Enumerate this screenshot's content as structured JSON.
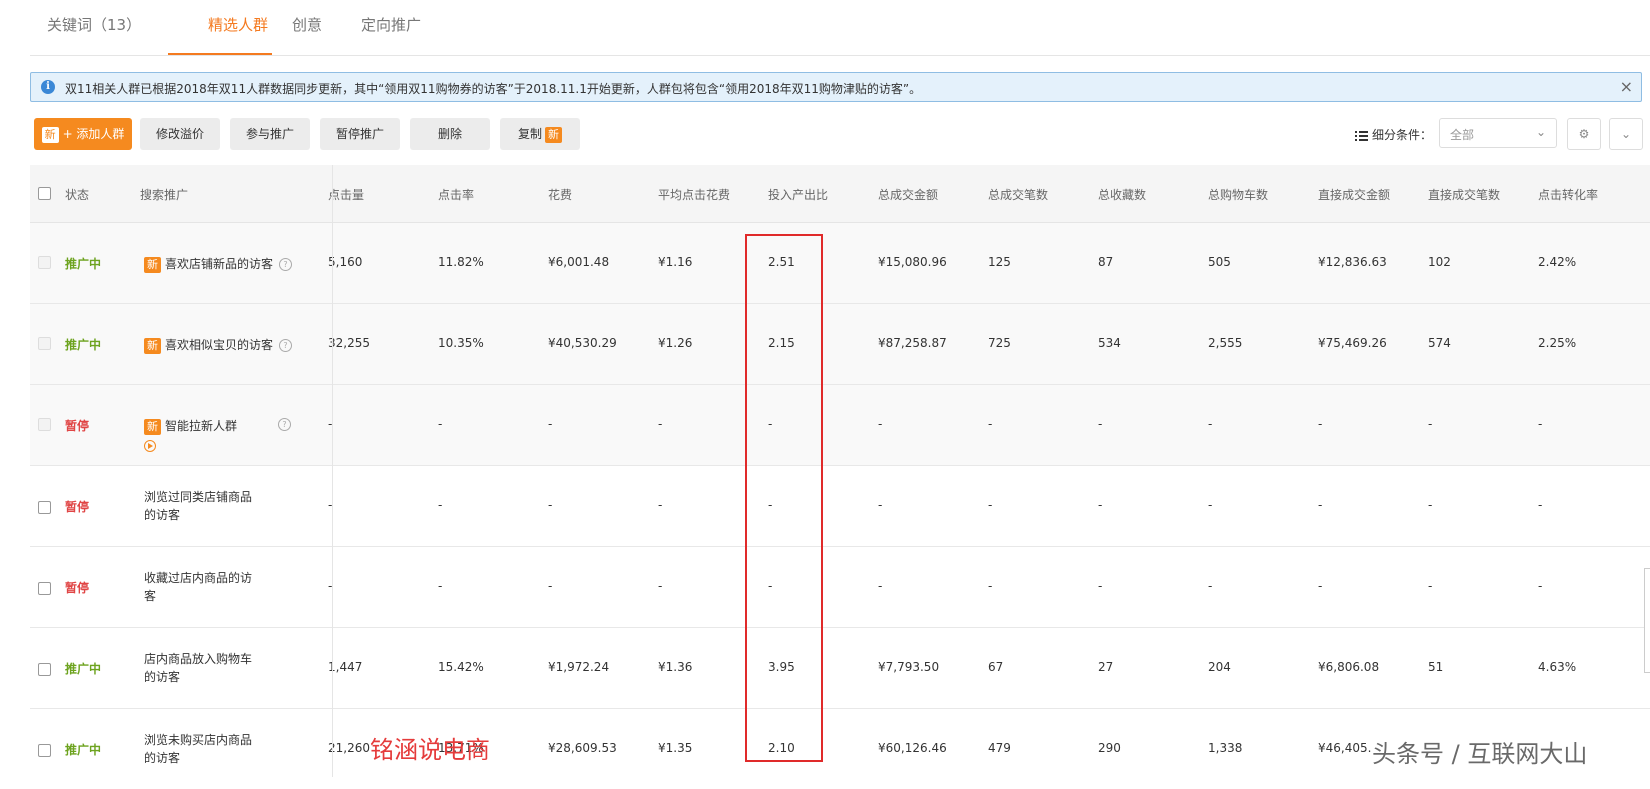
{
  "tabs": [
    {
      "label": "关键词（13）"
    },
    {
      "label": "精选人群"
    },
    {
      "label": "创意"
    },
    {
      "label": "定向推广"
    }
  ],
  "notice": {
    "text": "双11相关人群已根据2018年双11人群数据同步更新，其中“领用双11购物券的访客”于2018.11.1开始更新，人群包将包含“领用2018年双11购物津贴的访客”。",
    "close": "×"
  },
  "toolbar": {
    "add_new_tag": "新",
    "add_label": "+ 添加人群",
    "modify_premium": "修改溢价",
    "join_promo": "参与推广",
    "pause_promo": "暂停推广",
    "delete": "删除",
    "copy": "复制",
    "copy_tag": "新",
    "filter_label": "细分条件：",
    "filter_value": "全部"
  },
  "table": {
    "headers": [
      "状态",
      "搜索推广",
      "点击量",
      "点击率",
      "花费",
      "平均点击花费",
      "投入产出比",
      "总成交金额",
      "总成交笔数",
      "总收藏数",
      "总购物车数",
      "直接成交金额",
      "直接成交笔数",
      "点击转化率"
    ],
    "rows": [
      {
        "status": "推广中",
        "status_type": "on",
        "new": "新",
        "name1": "喜欢店铺新品的访客",
        "name2": "",
        "help": "?",
        "clicks": "5,160",
        "ctr": "11.82%",
        "cost": "¥6,001.48",
        "cpc": "¥1.16",
        "roi": "2.51",
        "gmv": "¥15,080.96",
        "orders": "125",
        "favs": "87",
        "carts": "505",
        "direct_gmv": "¥12,836.63",
        "direct_orders": "102",
        "cvr": "2.42%"
      },
      {
        "status": "推广中",
        "status_type": "on",
        "new": "新",
        "name1": "喜欢相似宝贝的访客",
        "name2": "",
        "help": "?",
        "clicks": "32,255",
        "ctr": "10.35%",
        "cost": "¥40,530.29",
        "cpc": "¥1.26",
        "roi": "2.15",
        "gmv": "¥87,258.87",
        "orders": "725",
        "favs": "534",
        "carts": "2,555",
        "direct_gmv": "¥75,469.26",
        "direct_orders": "574",
        "cvr": "2.25%"
      },
      {
        "status": "暂停",
        "status_type": "off",
        "new": "新",
        "name1": "智能拉新人群",
        "name2": "",
        "help": "?",
        "clicks": "-",
        "ctr": "-",
        "cost": "-",
        "cpc": "-",
        "roi": "-",
        "gmv": "-",
        "orders": "-",
        "favs": "-",
        "carts": "-",
        "direct_gmv": "-",
        "direct_orders": "-",
        "cvr": "-"
      },
      {
        "status": "暂停",
        "status_type": "off",
        "new": "",
        "name1": "浏览过同类店铺商品",
        "name2": "的访客",
        "help": "",
        "clicks": "-",
        "ctr": "-",
        "cost": "-",
        "cpc": "-",
        "roi": "-",
        "gmv": "-",
        "orders": "-",
        "favs": "-",
        "carts": "-",
        "direct_gmv": "-",
        "direct_orders": "-",
        "cvr": "-"
      },
      {
        "status": "暂停",
        "status_type": "off",
        "new": "",
        "name1": "收藏过店内商品的访",
        "name2": "客",
        "help": "",
        "clicks": "-",
        "ctr": "-",
        "cost": "-",
        "cpc": "-",
        "roi": "-",
        "gmv": "-",
        "orders": "-",
        "favs": "-",
        "carts": "-",
        "direct_gmv": "-",
        "direct_orders": "-",
        "cvr": "-"
      },
      {
        "status": "推广中",
        "status_type": "on",
        "new": "",
        "name1": "店内商品放入购物车",
        "name2": "的访客",
        "help": "",
        "clicks": "1,447",
        "ctr": "15.42%",
        "cost": "¥1,972.24",
        "cpc": "¥1.36",
        "roi": "3.95",
        "gmv": "¥7,793.50",
        "orders": "67",
        "favs": "27",
        "carts": "204",
        "direct_gmv": "¥6,806.08",
        "direct_orders": "51",
        "cvr": "4.63%"
      },
      {
        "status": "推广中",
        "status_type": "on",
        "new": "",
        "name1": "浏览未购买店内商品",
        "name2": "的访客",
        "help": "",
        "clicks": "21,260",
        "ctr": "13.71%",
        "cost": "¥28,609.53",
        "cpc": "¥1.35",
        "roi": "2.10",
        "gmv": "¥60,126.46",
        "orders": "479",
        "favs": "290",
        "carts": "1,338",
        "direct_gmv": "¥46,405.",
        "direct_orders": "",
        "cvr": ""
      }
    ]
  },
  "watermarks": {
    "left": "铭涵说电商",
    "right": "头条号 / 互联网大山"
  },
  "colors": {
    "accent": "#f47a20",
    "status_on": "#6da31f",
    "status_off": "#e04545",
    "highlight": "#e02a2a"
  }
}
